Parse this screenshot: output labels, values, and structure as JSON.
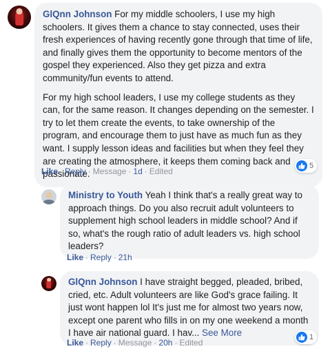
{
  "comments": [
    {
      "author": "GlQnn Johnson",
      "paragraphs": [
        "For my middle schoolers, I use my high schoolers. It gives them a chance to stay connected, uses their fresh experiences of having recently gone through that time of life, and finally gives them the opportunity to become mentors of the gospel they experienced. Also they get pizza and extra community/fun events to attend.",
        "For my high school leaders, I use my college students as they can, for the same reason. It changes depending on the semester. I try to let them create the events, to take ownership of the program, and encourage them to just have as much fun as they want. I supply lesson ideas and facilities but when they feel they are creating the atmosphere, it keeps them coming back and passionate."
      ],
      "actions": {
        "like": "Like",
        "reply": "Reply",
        "message": "Message",
        "time": "1d",
        "edited": "Edited"
      },
      "reaction_count": "5"
    },
    {
      "author": "Ministry to Youth",
      "text": "Yeah I think that's a really great way to approach things. Do you also recruit adult volunteers to supplement high school leaders in middle school? And if so, what's the rough ratio of adult leaders vs. high school leaders?",
      "actions": {
        "like": "Like",
        "reply": "Reply",
        "time": "21h"
      }
    },
    {
      "author": "GlQnn Johnson",
      "text": "I have straight begged, pleaded, bribed, cried, etc. Adult volunteers are like God's grace failing. It just wont happen lol It's just me for almost two years now, except one parent who fills in on my one weekend a month I have air national guard. I hav...",
      "see_more": "See More",
      "actions": {
        "like": "Like",
        "reply": "Reply",
        "message": "Message",
        "time": "20h",
        "edited": "Edited"
      },
      "reaction_count": "1"
    }
  ],
  "colors": {
    "link": "#385898",
    "meta": "#90949c",
    "bubble": "#f2f3f5",
    "like_badge": "#1877f2"
  },
  "icons": {
    "reaction": "thumbs-up-icon"
  }
}
